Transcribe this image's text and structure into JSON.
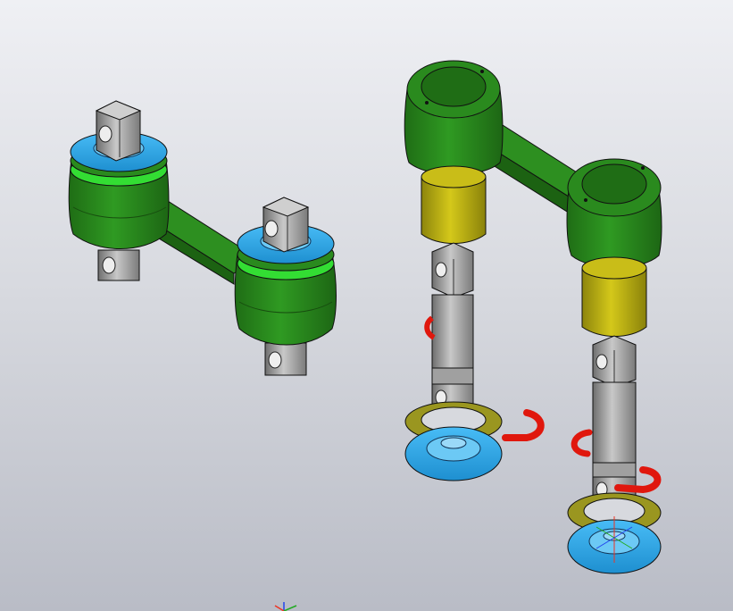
{
  "viewport": {
    "background_top": "#eff0f4",
    "background_bottom": "#b9bcc6"
  },
  "colors": {
    "arm_green": "#2a8a1e",
    "arm_green_dark": "#1f6a14",
    "seal_lime": "#33dd33",
    "cap_blue": "#2fa8e8",
    "sleeve_olive": "#b8ad10",
    "washer_olive": "#9a9620",
    "clip_red": "#e0170d",
    "pin_gray": "#9c9c9c"
  },
  "scene": {
    "assembly_left": {
      "name": "assembled-arm",
      "icon": "assembled-arm-icon"
    },
    "assembly_right": {
      "name": "exploded-arm",
      "icon": "exploded-arm-icon"
    },
    "triad": {
      "icon": "coordinate-triad-icon"
    }
  }
}
